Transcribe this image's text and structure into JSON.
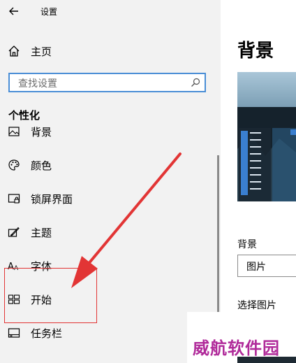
{
  "window": {
    "title": "设置"
  },
  "sidebar": {
    "home_label": "主页",
    "search_placeholder": "查找设置",
    "section_title": "个性化",
    "items": [
      {
        "label": "背景",
        "icon": "image-icon"
      },
      {
        "label": "颜色",
        "icon": "palette-icon"
      },
      {
        "label": "锁屏界面",
        "icon": "lock-screen-icon"
      },
      {
        "label": "主题",
        "icon": "theme-brush-icon"
      },
      {
        "label": "字体",
        "icon": "font-icon"
      },
      {
        "label": "开始",
        "icon": "start-tiles-icon"
      },
      {
        "label": "任务栏",
        "icon": "taskbar-icon"
      }
    ]
  },
  "content": {
    "heading": "背景",
    "background_label": "背景",
    "background_value": "图片",
    "choose_picture_label": "选择图片"
  },
  "watermark": "威航软件园",
  "colors": {
    "accent": "#4a8ed6",
    "annotation_red": "#e23535",
    "watermark": "#b02a9a"
  }
}
